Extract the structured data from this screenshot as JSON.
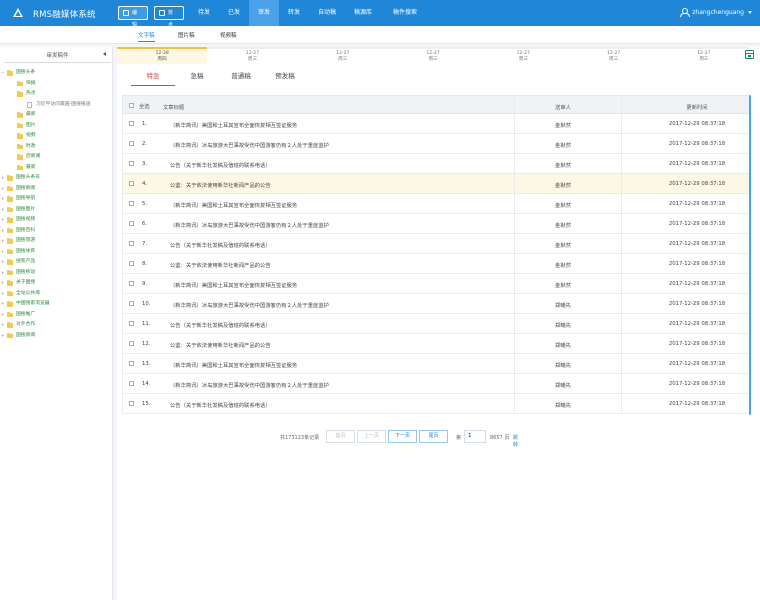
{
  "app": {
    "title": "RMS融媒体系统"
  },
  "roles": [
    "编辑",
    "技术"
  ],
  "nav": [
    "待发",
    "已发",
    "审发",
    "转发",
    "自动稿",
    "稿源库",
    "稿件搜索"
  ],
  "nav_active_index": 2,
  "user": {
    "name": "zhangchenguang"
  },
  "subtabs": [
    "文字稿",
    "图片稿",
    "视频稿"
  ],
  "sidebar": {
    "title": "审发稿件",
    "tree": [
      {
        "label": "国搜头条",
        "level": 0,
        "toggle": "−"
      },
      {
        "label": "快报",
        "level": 1
      },
      {
        "label": "热点",
        "level": 1
      },
      {
        "label": "习近平访问美国-国搜报道",
        "level": 2,
        "doc": true
      },
      {
        "label": "最新",
        "level": 1
      },
      {
        "label": "图片",
        "level": 1
      },
      {
        "label": "视频",
        "level": 1
      },
      {
        "label": "时政",
        "level": 1
      },
      {
        "label": "后新闻",
        "level": 1
      },
      {
        "label": "最新",
        "level": 1
      },
      {
        "label": "国搜头条号",
        "level": 0,
        "toggle": "+"
      },
      {
        "label": "国搜新闻",
        "level": 0,
        "toggle": "+"
      },
      {
        "label": "国搜导航",
        "level": 0,
        "toggle": "+"
      },
      {
        "label": "国搜图片",
        "level": 0,
        "toggle": "+"
      },
      {
        "label": "国搜视频",
        "level": 0,
        "toggle": "+"
      },
      {
        "label": "国搜百科",
        "level": 0,
        "toggle": "+"
      },
      {
        "label": "国搜旅游",
        "level": 0,
        "toggle": "+"
      },
      {
        "label": "国搜体育",
        "level": 0,
        "toggle": "+"
      },
      {
        "label": "搜索产品",
        "level": 0,
        "toggle": "+"
      },
      {
        "label": "国搜移动",
        "level": 0,
        "toggle": "+"
      },
      {
        "label": "关于国搜",
        "level": 0,
        "toggle": "+"
      },
      {
        "label": "全站公共库",
        "level": 0,
        "toggle": "+"
      },
      {
        "label": "中国搜索浏览器",
        "level": 0,
        "toggle": "+"
      },
      {
        "label": "国搜推广",
        "level": 0,
        "toggle": "+"
      },
      {
        "label": "对外合作",
        "level": 0,
        "toggle": "+"
      },
      {
        "label": "国搜新闻",
        "level": 0,
        "toggle": "+"
      }
    ]
  },
  "dates": [
    {
      "date": "12-28",
      "weekday": "周四"
    },
    {
      "date": "12-27",
      "weekday": "周三"
    },
    {
      "date": "12-27",
      "weekday": "周三"
    },
    {
      "date": "12-27",
      "weekday": "周三"
    },
    {
      "date": "12-27",
      "weekday": "周三"
    },
    {
      "date": "12-27",
      "weekday": "周三"
    },
    {
      "date": "12-27",
      "weekday": "周三"
    }
  ],
  "priority_tabs": [
    "特急",
    "急稿",
    "普通稿",
    "预发稿"
  ],
  "table": {
    "headers": {
      "select_all": "全选",
      "title": "文章标题",
      "sender": "送审人",
      "time": "更新时间"
    },
    "rows": [
      {
        "num": "1.",
        "title": "（新华简讯）美国和土耳其宣布全面恢复相互签证服务",
        "sender": "金默然",
        "time": "2017-12-29 08:37:18"
      },
      {
        "num": "2.",
        "title": "（新华简讯）冰岛旅游大巴事故受伤中国游客仍有２人处于重症监护",
        "sender": "金默然",
        "time": "2017-12-29 08:37:18"
      },
      {
        "num": "3.",
        "title": "公告（关于新华社发稿及值班的联系电话）",
        "sender": "金默然",
        "time": "2017-12-29 08:37:18"
      },
      {
        "num": "4.",
        "title": "公鉴：关于依法使用新华社新闻产品的公告",
        "sender": "金默然",
        "time": "2017-12-29 08:37:18"
      },
      {
        "num": "5.",
        "title": "（新华简讯）美国和土耳其宣布全面恢复相互签证服务",
        "sender": "金默然",
        "time": "2017-12-29 08:37:18"
      },
      {
        "num": "6.",
        "title": "（新华简讯）冰岛旅游大巴事故受伤中国游客仍有２人处于重症监护",
        "sender": "金默然",
        "time": "2017-12-29 08:37:18"
      },
      {
        "num": "7.",
        "title": "公告（关于新华社发稿及值班的联系电话）",
        "sender": "金默然",
        "time": "2017-12-29 08:37:18"
      },
      {
        "num": "8.",
        "title": "公鉴：关于依法使用新华社新闻产品的公告",
        "sender": "金默然",
        "time": "2017-12-29 08:37:18"
      },
      {
        "num": "9.",
        "title": "（新华简讯）美国和土耳其宣布全面恢复相互签证服务",
        "sender": "金默然",
        "time": "2017-12-29 08:37:18"
      },
      {
        "num": "10.",
        "title": "（新华简讯）冰岛旅游大巴事故受伤中国游客仍有２人处于重症监护",
        "sender": "郑曦先",
        "time": "2017-12-29 08:37:18"
      },
      {
        "num": "11.",
        "title": "公告（关于新华社发稿及值班的联系电话）",
        "sender": "郑曦先",
        "time": "2017-12-29 08:37:18"
      },
      {
        "num": "12.",
        "title": "公鉴：关于依法使用新华社新闻产品的公告",
        "sender": "郑曦先",
        "time": "2017-12-29 08:37:18"
      },
      {
        "num": "13.",
        "title": "（新华简讯）美国和土耳其宣布全面恢复相互签证服务",
        "sender": "郑曦先",
        "time": "2017-12-29 08:37:18"
      },
      {
        "num": "14.",
        "title": "（新华简讯）冰岛旅游大巴事故受伤中国游客仍有２人处于重症监护",
        "sender": "郑曦先",
        "time": "2017-12-29 08:37:18"
      },
      {
        "num": "15.",
        "title": "公告（关于新华社发稿及值班的联系电话）",
        "sender": "郑曦先",
        "time": "2017-12-29 08:37:18"
      }
    ]
  },
  "pager": {
    "total_text": "共173123条记录",
    "first": "首页",
    "prev": "上一页",
    "next": "下一页",
    "last": "尾页",
    "page_prefix": "第",
    "page_value": "1",
    "page_suffix": "8657 页",
    "go": "跳转"
  },
  "colors": {
    "brand": "#1f86d8",
    "accent_red": "#e04040",
    "tree_green": "#2c8a3f",
    "folder": "#f6c94a"
  }
}
